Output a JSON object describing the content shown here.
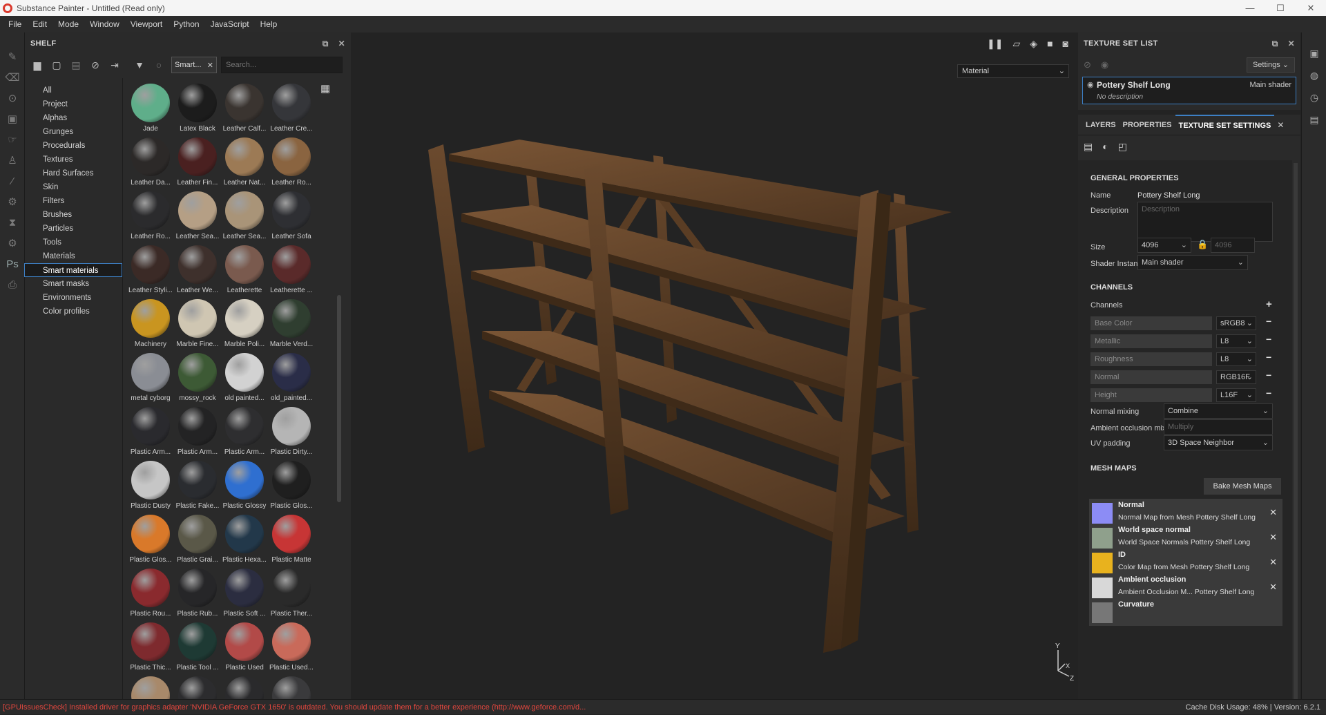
{
  "window": {
    "title": "Substance Painter - Untitled (Read only)",
    "controls": [
      "—",
      "☐",
      "✕"
    ]
  },
  "menu": [
    "File",
    "Edit",
    "Mode",
    "Window",
    "Viewport",
    "Python",
    "JavaScript",
    "Help"
  ],
  "shelf": {
    "title": "SHELF",
    "filter_chip": "Smart...",
    "search_placeholder": "Search...",
    "categories": [
      "All",
      "Project",
      "Alphas",
      "Grunges",
      "Procedurals",
      "Textures",
      "Hard Surfaces",
      "Skin",
      "Filters",
      "Brushes",
      "Particles",
      "Tools",
      "Materials",
      "Smart materials",
      "Smart masks",
      "Environments",
      "Color profiles"
    ],
    "active_category": "Smart materials",
    "materials": [
      {
        "name": "Jade",
        "color": "#5fae8a"
      },
      {
        "name": "Latex Black",
        "color": "#1c1c1c"
      },
      {
        "name": "Leather Calf...",
        "color": "#3a3430"
      },
      {
        "name": "Leather Cre...",
        "color": "#35363a"
      },
      {
        "name": "Leather Da...",
        "color": "#2c2928"
      },
      {
        "name": "Leather Fin...",
        "color": "#4a2020"
      },
      {
        "name": "Leather Nat...",
        "color": "#9c7a55"
      },
      {
        "name": "Leather Ro...",
        "color": "#8a6440"
      },
      {
        "name": "Leather Ro...",
        "color": "#2b2b2d"
      },
      {
        "name": "Leather Sea...",
        "color": "#b59f85"
      },
      {
        "name": "Leather Sea...",
        "color": "#a99478"
      },
      {
        "name": "Leather Sofa",
        "color": "#2e2f33"
      },
      {
        "name": "Leather Styli...",
        "color": "#3b2a26"
      },
      {
        "name": "Leather We...",
        "color": "#3e302c"
      },
      {
        "name": "Leatherette",
        "color": "#7a5a4e"
      },
      {
        "name": "Leatherette ...",
        "color": "#5a2a2a"
      },
      {
        "name": "Machinery",
        "color": "#c99520"
      },
      {
        "name": "Marble Fine...",
        "color": "#cfc6b2"
      },
      {
        "name": "Marble Poli...",
        "color": "#d6d0c2"
      },
      {
        "name": "Marble Verd...",
        "color": "#2f3e30"
      },
      {
        "name": "metal cyborg",
        "color": "#8a8d94"
      },
      {
        "name": "mossy_rock",
        "color": "#3d5a35"
      },
      {
        "name": "old painted...",
        "color": "#d2d2d2"
      },
      {
        "name": "old_painted...",
        "color": "#2a2d48"
      },
      {
        "name": "Plastic Arm...",
        "color": "#2a2a2e"
      },
      {
        "name": "Plastic Arm...",
        "color": "#232324"
      },
      {
        "name": "Plastic Arm...",
        "color": "#2e2e30"
      },
      {
        "name": "Plastic Dirty...",
        "color": "#b5b5b5"
      },
      {
        "name": "Plastic Dusty",
        "color": "#c6c6c6"
      },
      {
        "name": "Plastic Fake...",
        "color": "#2a2c30"
      },
      {
        "name": "Plastic Glossy",
        "color": "#2f6fd0"
      },
      {
        "name": "Plastic Glos...",
        "color": "#1f1f1f"
      },
      {
        "name": "Plastic Glos...",
        "color": "#d9792a"
      },
      {
        "name": "Plastic Grai...",
        "color": "#5a5848"
      },
      {
        "name": "Plastic Hexa...",
        "color": "#22384a"
      },
      {
        "name": "Plastic Matte",
        "color": "#c73535"
      },
      {
        "name": "Plastic Rou...",
        "color": "#8a2a2e"
      },
      {
        "name": "Plastic Rub...",
        "color": "#262628"
      },
      {
        "name": "Plastic Soft ...",
        "color": "#2b2d40"
      },
      {
        "name": "Plastic Ther...",
        "color": "#2a2a2a"
      },
      {
        "name": "Plastic Thic...",
        "color": "#7e2a2e"
      },
      {
        "name": "Plastic Tool ...",
        "color": "#1e3a34"
      },
      {
        "name": "Plastic Used",
        "color": "#b24a48"
      },
      {
        "name": "Plastic Used...",
        "color": "#c96a5a"
      },
      {
        "name": "",
        "color": "#a8896a"
      },
      {
        "name": "",
        "color": "#2c2c2e"
      },
      {
        "name": "",
        "color": "#2a2a2c"
      },
      {
        "name": "",
        "color": "#3a3a3c"
      }
    ]
  },
  "viewport": {
    "mode": "Material"
  },
  "texture_set_list": {
    "title": "TEXTURE SET LIST",
    "settings_label": "Settings",
    "item_name": "Pottery Shelf Long",
    "item_shader": "Main shader",
    "item_description": "No description"
  },
  "tabs": [
    "LAYERS",
    "PROPERTIES",
    "TEXTURE SET SETTINGS"
  ],
  "active_tab": "TEXTURE SET SETTINGS",
  "tss": {
    "general_title": "GENERAL PROPERTIES",
    "name_label": "Name",
    "name_value": "Pottery Shelf Long",
    "description_label": "Description",
    "description_placeholder": "Description",
    "size_label": "Size",
    "size_value": "4096",
    "size_locked_value": "4096",
    "shader_instance_label": "Shader Instance",
    "shader_instance_value": "Main shader",
    "channels_title": "CHANNELS",
    "channels_label": "Channels",
    "channels": [
      {
        "name": "Base Color",
        "format": "sRGB8"
      },
      {
        "name": "Metallic",
        "format": "L8"
      },
      {
        "name": "Roughness",
        "format": "L8"
      },
      {
        "name": "Normal",
        "format": "RGB16F"
      },
      {
        "name": "Height",
        "format": "L16F"
      }
    ],
    "normal_mixing_label": "Normal mixing",
    "normal_mixing_value": "Combine",
    "ao_mixing_label": "Ambient occlusion mixing",
    "ao_mixing_value": "Multiply",
    "uv_padding_label": "UV padding",
    "uv_padding_value": "3D Space Neighbor",
    "mesh_maps_title": "MESH MAPS",
    "bake_label": "Bake Mesh Maps",
    "mesh_maps": [
      {
        "title": "Normal",
        "subtitle": "Normal Map from Mesh Pottery Shelf Long",
        "color": "#8c8cf5"
      },
      {
        "title": "World space normal",
        "subtitle": "World Space Normals Pottery Shelf Long",
        "color": "#8fa08c"
      },
      {
        "title": "ID",
        "subtitle": "Color Map from Mesh Pottery Shelf Long",
        "color": "#e8b21e"
      },
      {
        "title": "Ambient occlusion",
        "subtitle": "Ambient Occlusion M... Pottery Shelf Long",
        "color": "#d8d8d8"
      },
      {
        "title": "Curvature",
        "subtitle": "",
        "color": "#777777"
      }
    ]
  },
  "status": {
    "message": "[GPUIssuesCheck] Installed driver for graphics adapter 'NVIDIA GeForce GTX 1650' is outdated. You should update them for a better experience (http://www.geforce.com/d...",
    "cache": "Cache Disk Usage:   48% | Version: 6.2.1"
  }
}
